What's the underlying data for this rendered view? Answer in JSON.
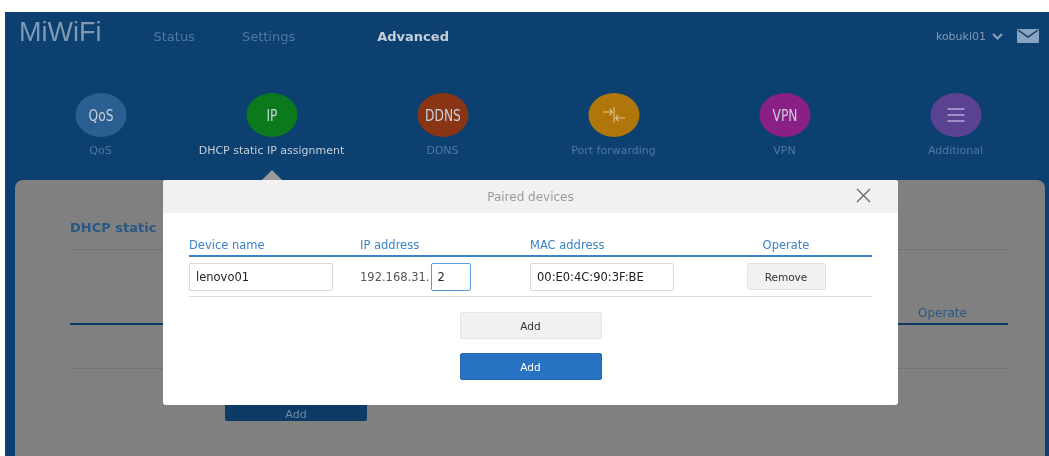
{
  "brand": "MiWiFi",
  "nav": [
    {
      "label": "Status",
      "selected": false
    },
    {
      "label": "Settings",
      "selected": false
    },
    {
      "label": "Advanced",
      "selected": true
    }
  ],
  "user": "kobuki01",
  "features": [
    {
      "kind": "text",
      "icon_text": "QoS",
      "label": "QoS",
      "color": "#2c5f91",
      "selected": false
    },
    {
      "kind": "text",
      "icon_text": "IP",
      "label": "DHCP static IP assignment",
      "color": "#0b7a1c",
      "selected": true
    },
    {
      "kind": "text",
      "icon_text": "DDNS",
      "label": "DDNS",
      "color": "#8a3416",
      "selected": false
    },
    {
      "kind": "arrows",
      "label": "Port forwarding",
      "color": "#b0760a",
      "selected": false
    },
    {
      "kind": "text",
      "icon_text": "VPN",
      "label": "VPN",
      "color": "#8a1f86",
      "selected": false
    },
    {
      "kind": "menu",
      "label": "Additional",
      "color": "#5b4192",
      "selected": false
    }
  ],
  "page": {
    "title": "DHCP static",
    "columns": [
      "Operate"
    ],
    "add_button": "Add"
  },
  "dialog": {
    "title": "Paired devices",
    "columns": [
      "Device name",
      "IP address",
      "MAC address",
      "Operate"
    ],
    "rows": [
      {
        "name": "lenovo01",
        "ip_prefix": "192.168.31.",
        "ip_suffix": "2",
        "ip_focused": true,
        "mac": "00:E0:4C:90:3F:BE",
        "action": "Remove"
      }
    ],
    "buttons": [
      {
        "kind": "secondary",
        "label": "Add"
      },
      {
        "kind": "primary",
        "label": "Add"
      }
    ]
  }
}
